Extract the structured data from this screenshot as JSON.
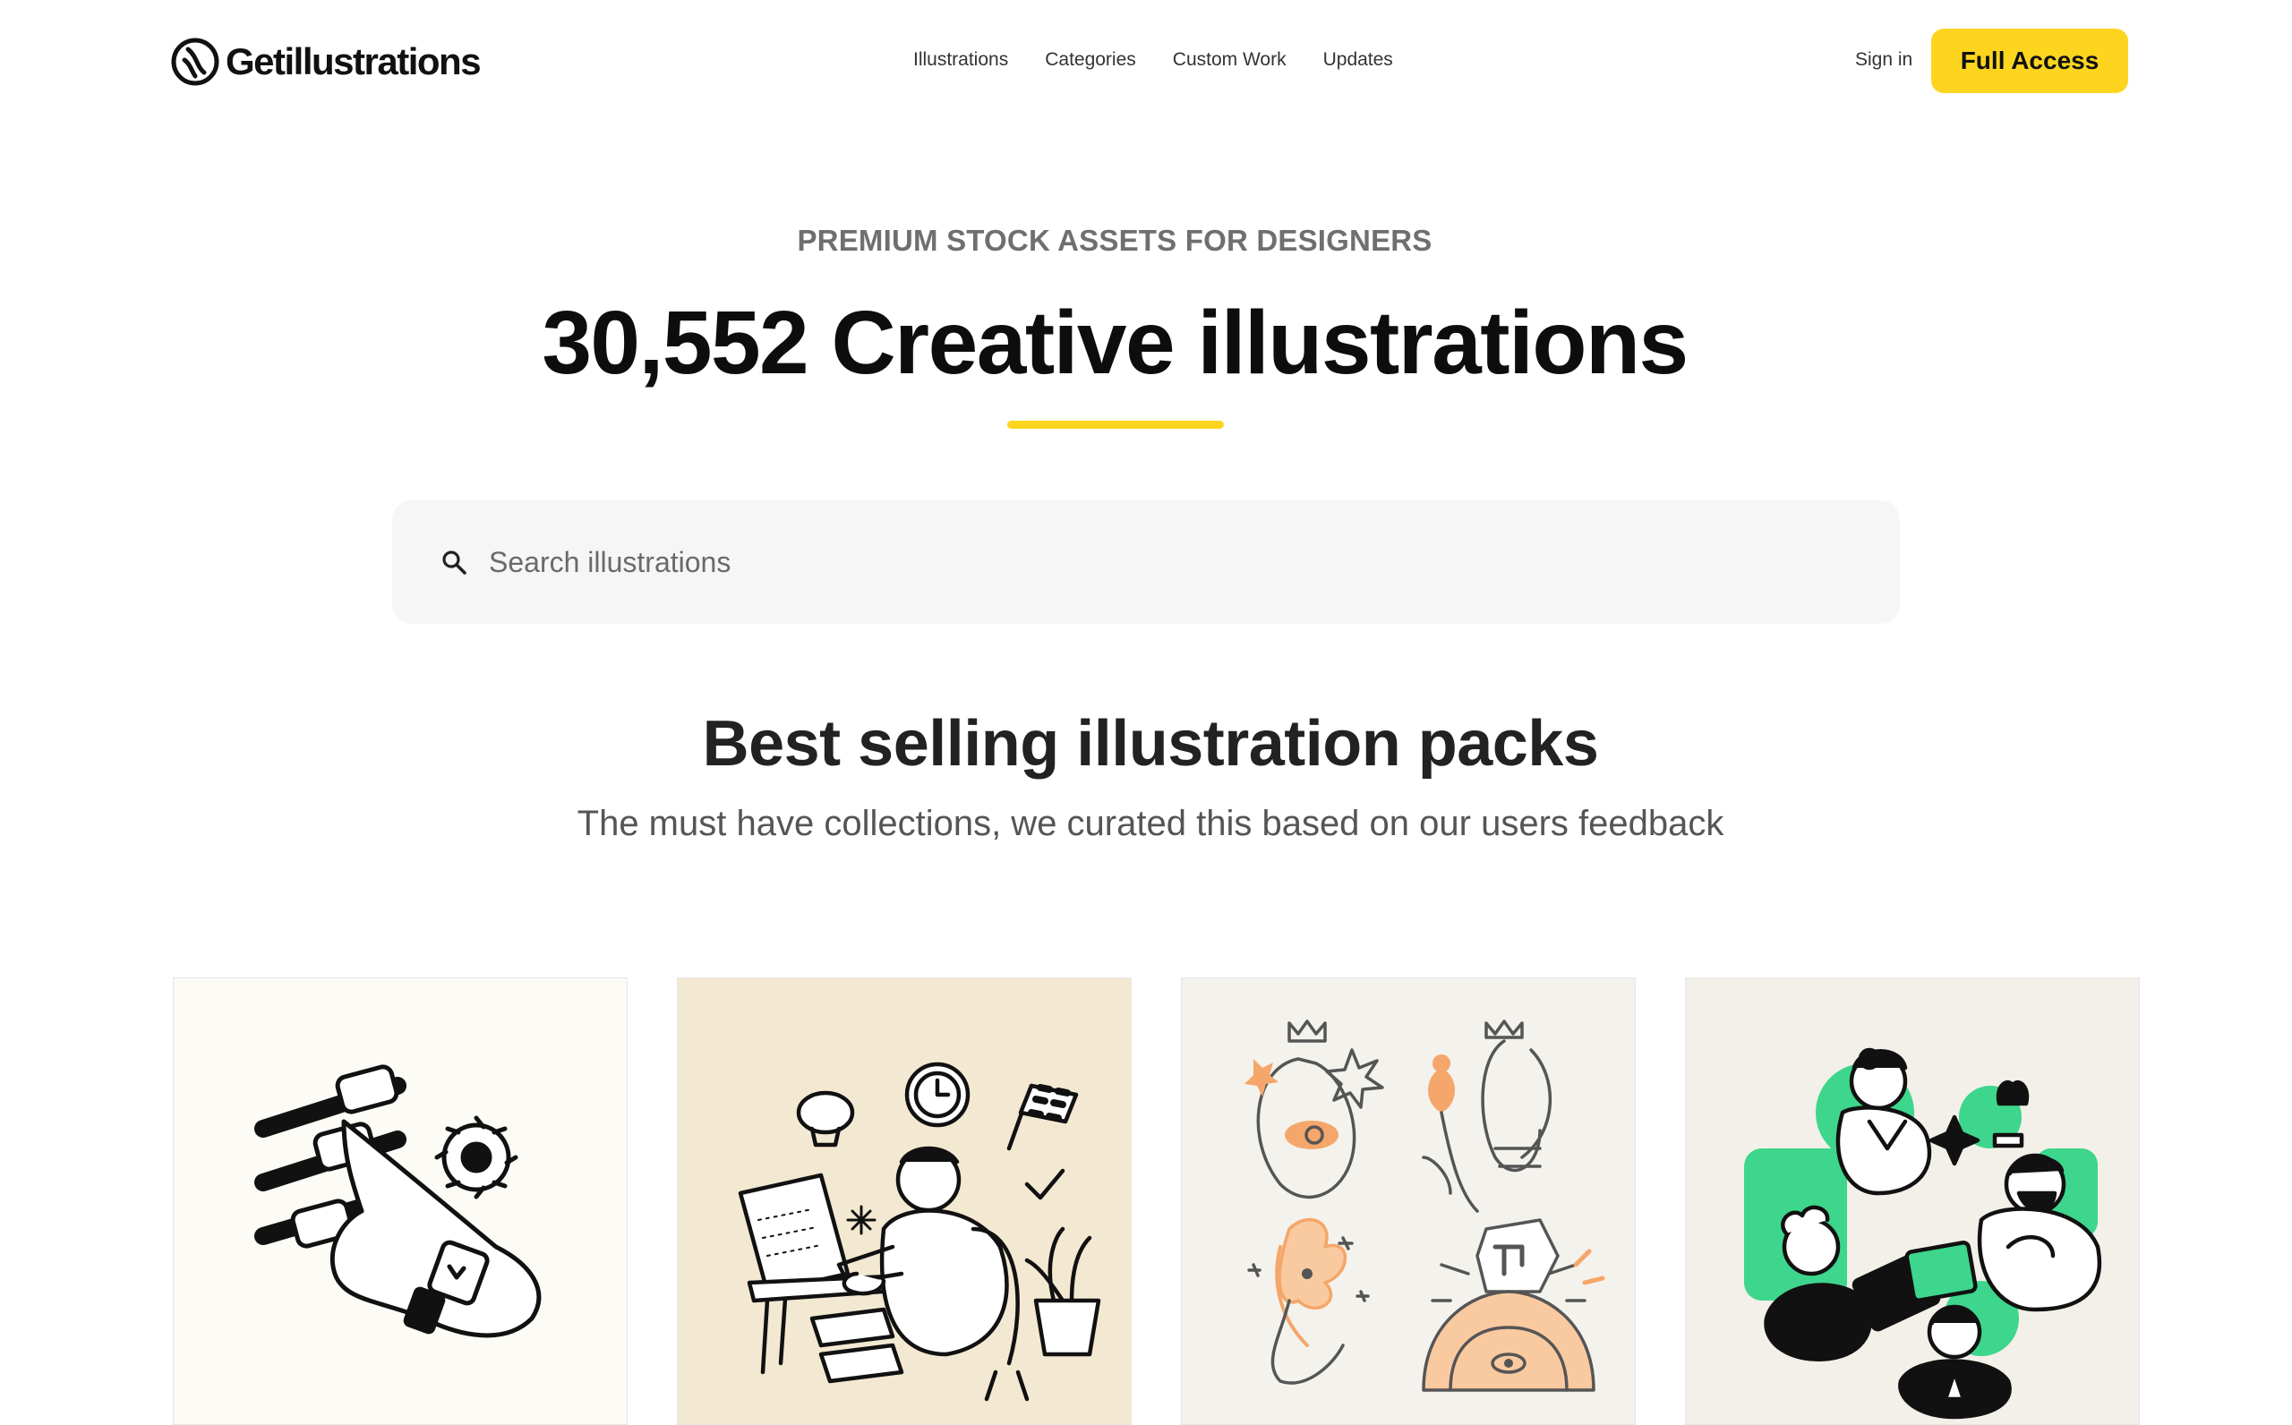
{
  "header": {
    "logo_text": "Getillustrations",
    "nav": [
      "Illustrations",
      "Categories",
      "Custom Work",
      "Updates"
    ],
    "sign_in": "Sign in",
    "cta_label": "Full Access"
  },
  "hero": {
    "eyebrow": "PREMIUM STOCK ASSETS FOR DESIGNERS",
    "headline": "30,552 Creative illustrations"
  },
  "search": {
    "placeholder": "Search illustrations"
  },
  "section": {
    "title": "Best selling illustration packs",
    "subtitle": "The must have collections, we curated this based on our users feedback"
  },
  "cards": [
    {
      "background": "#FDFBF5",
      "icon": "hand-with-sliders-and-gear"
    },
    {
      "background": "#F3E8D1",
      "icon": "person-working-at-laptop-with-ideas"
    },
    {
      "background": "#F4F2EC",
      "icon": "abstract-portraits-with-flowers"
    },
    {
      "background": "#F2F0E8",
      "icon": "team-collaboration-people"
    }
  ],
  "colors": {
    "accent": "#FDD51F",
    "text": "#111111",
    "muted": "#6f6f6f",
    "search_bg": "#F6F6F6",
    "green": "#3DD68C",
    "peach": "#F5A66A"
  }
}
